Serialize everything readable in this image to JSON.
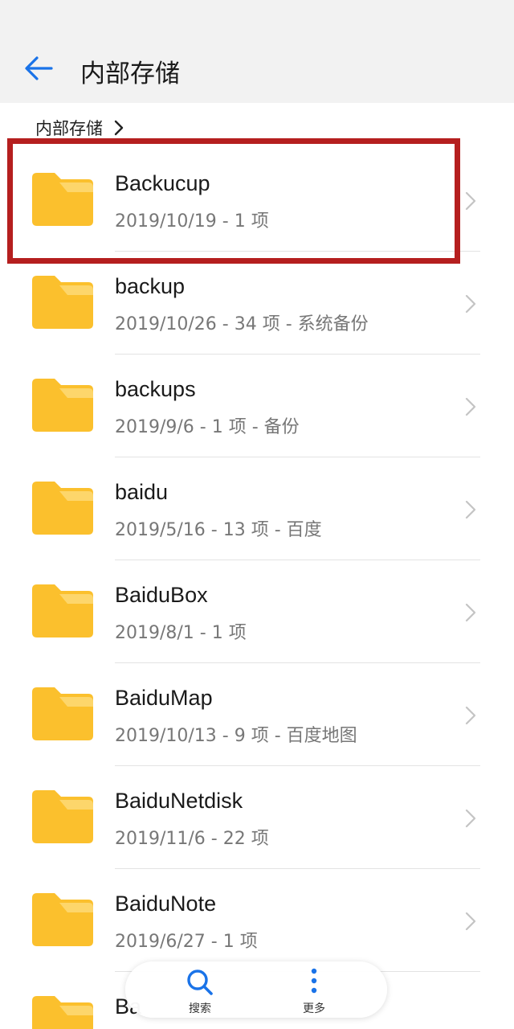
{
  "header": {
    "title": "内部存储"
  },
  "breadcrumb": {
    "label": "内部存储"
  },
  "folders": [
    {
      "name": "Backucup",
      "meta": "2019/10/19 - 1 项"
    },
    {
      "name": "backup",
      "meta": "2019/10/26 - 34 项 - 系统备份"
    },
    {
      "name": "backups",
      "meta": "2019/9/6 - 1 项 - 备份"
    },
    {
      "name": "baidu",
      "meta": "2019/5/16 - 13 项 - 百度"
    },
    {
      "name": "BaiduBox",
      "meta": "2019/8/1 - 1 项"
    },
    {
      "name": "BaiduMap",
      "meta": "2019/10/13 - 9 项 - 百度地图"
    },
    {
      "name": "BaiduNetdisk",
      "meta": "2019/11/6 - 22 项"
    },
    {
      "name": "BaiduNote",
      "meta": "2019/6/27 - 1 项"
    },
    {
      "name": "Ba",
      "meta": ""
    }
  ],
  "bottom_nav": {
    "search_label": "搜索",
    "more_label": "更多"
  },
  "colors": {
    "accent": "#1a73e8",
    "folder": "#fbc02d",
    "folder_tab": "#fdd66b",
    "highlight": "#b51f1f"
  },
  "icons": {
    "back": "arrow-left-icon",
    "folder": "folder-icon",
    "chevron": "chevron-right-icon",
    "search": "search-icon",
    "more": "more-vertical-icon"
  }
}
